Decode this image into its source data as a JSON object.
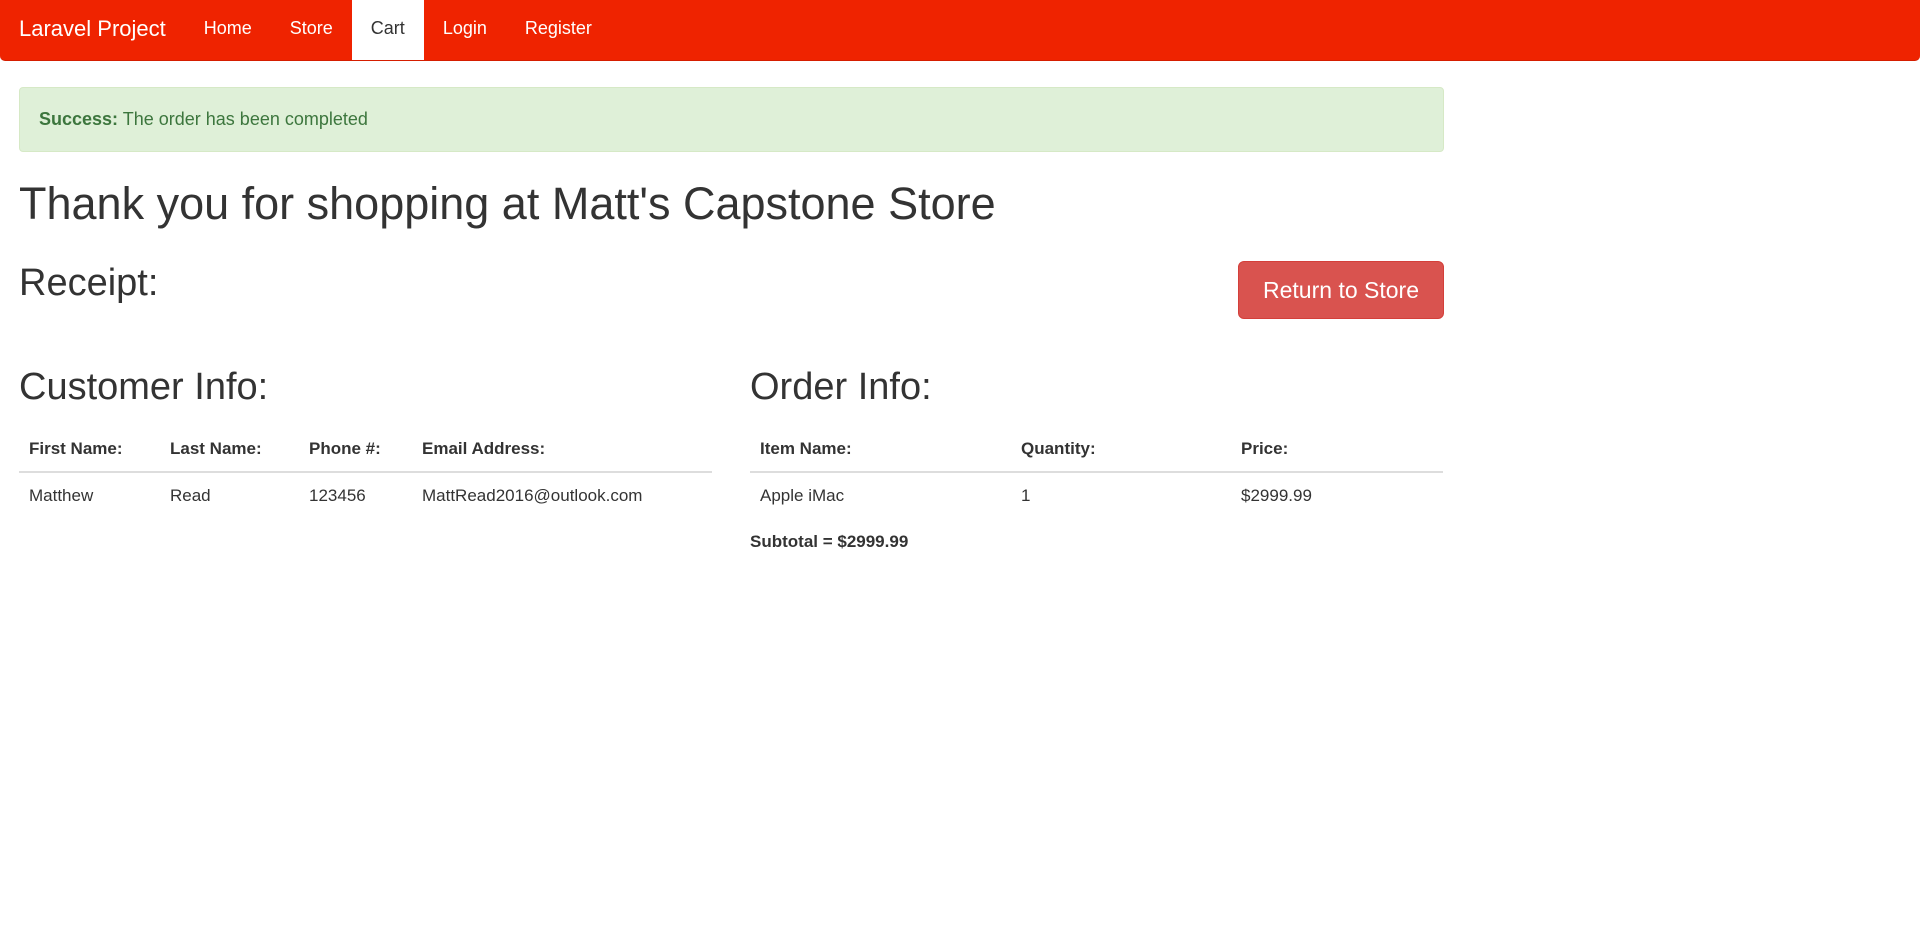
{
  "navbar": {
    "brand": "Laravel Project",
    "items": [
      {
        "label": "Home",
        "active": false
      },
      {
        "label": "Store",
        "active": false
      },
      {
        "label": "Cart",
        "active": true
      },
      {
        "label": "Login",
        "active": false
      },
      {
        "label": "Register",
        "active": false
      }
    ],
    "background": "#ef2300"
  },
  "alert": {
    "label": "Success:",
    "message": "The order has been completed",
    "background": "#dff0d8",
    "text_color": "#3c763d"
  },
  "title": "Thank you for shopping at Matt's Capstone Store",
  "receipt": {
    "heading": "Receipt:",
    "return_button": "Return to Store",
    "button_color": "#d9534f"
  },
  "customer": {
    "heading": "Customer Info:",
    "columns": [
      "First Name:",
      "Last Name:",
      "Phone #:",
      "Email Address:"
    ],
    "rows": [
      [
        "Matthew",
        "Read",
        "123456",
        "MattRead2016@outlook.com"
      ]
    ]
  },
  "order": {
    "heading": "Order Info:",
    "columns": [
      "Item Name:",
      "Quantity:",
      "Price:"
    ],
    "rows": [
      [
        "Apple iMac",
        "1",
        "$2999.99"
      ]
    ],
    "subtotal": "Subtotal = $2999.99"
  }
}
